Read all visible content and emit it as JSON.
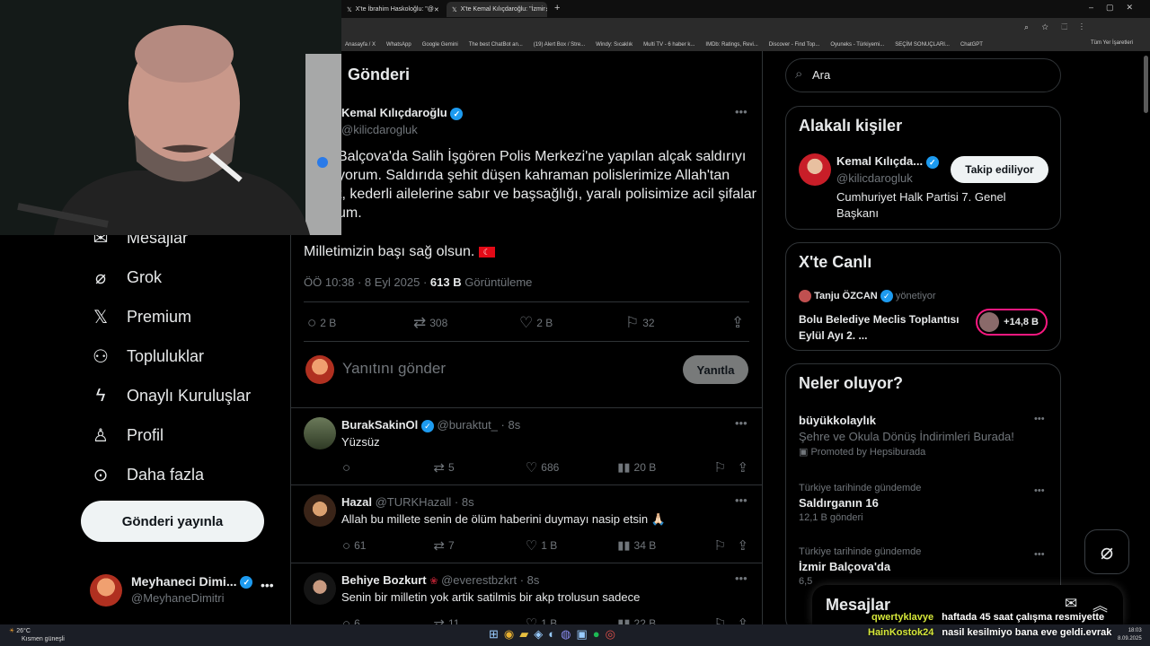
{
  "browser": {
    "tabs": [
      {
        "label": "X'te İbrahim Haskoloğlu: \"@"
      },
      {
        "label": "X'te Kemal Kılıçdaroğlu: \"İzmir"
      }
    ],
    "bookmarks": [
      "Anasayfa / X",
      "WhatsApp",
      "Google Gemini",
      "The best ChatBot an...",
      "(19) Alert Box / Stre...",
      "Windy: Sıcaklık",
      "Multi TV - 6 haber k...",
      "IMDb: Ratings, Revi...",
      "Discover - Find Top...",
      "Oyuneks - Türkiyemi...",
      "SEÇİM SONUÇLARI...",
      "ChatGPT"
    ],
    "all_bookmarks": "Tüm Yer İşaretleri"
  },
  "nav": {
    "items": [
      {
        "label": "Mesajlar",
        "icon": "mail-icon"
      },
      {
        "label": "Grok",
        "icon": "grok-icon"
      },
      {
        "label": "Premium",
        "icon": "x-logo-icon"
      },
      {
        "label": "Topluluklar",
        "icon": "communities-icon"
      },
      {
        "label": "Onaylı Kuruluşlar",
        "icon": "lightning-icon"
      },
      {
        "label": "Profil",
        "icon": "person-icon"
      },
      {
        "label": "Daha fazla",
        "icon": "more-circle-icon"
      }
    ],
    "post_button": "Gönderi yayınla",
    "account": {
      "name": "Meyhaneci Dimi...",
      "handle": "@MeyhaneDimitri"
    }
  },
  "main": {
    "header": "Gönderi",
    "post": {
      "author": "Kemal Kılıçdaroğlu",
      "handle": "@kilicdarogluk",
      "lines": [
        "Balçova'da Salih İşgören Polis Merkezi'ne yapılan alçak saldırıyı",
        "yorum. Saldırıda şehit düşen kahraman polislerimize Allah'tan",
        "t, kederli ailelerine sabır ve başsağlığı, yaralı polisimize acil şifalar",
        "um."
      ],
      "closing": "Milletimizin başı sağ olsun.",
      "time": "ÖÖ 10:38 · 8 Eyl 2025 ·",
      "views": "613 B",
      "views_label": "Görüntüleme",
      "replies": "2 B",
      "reposts": "308",
      "likes": "2 B",
      "bookmarks": "32"
    },
    "reply_box": {
      "placeholder": "Yanıtını gönder",
      "button": "Yanıtla"
    },
    "replies": [
      {
        "name": "BurakSakinOl",
        "handle": "@buraktut_ · 8s",
        "text": "Yüzsüz",
        "replies": "",
        "reposts": "5",
        "likes": "686",
        "views": "20 B"
      },
      {
        "name": "Hazal",
        "handle": "@TURKHazall · 8s",
        "text": "Allah bu millete senin de ölüm haberini duymayı nasip etsin 🙏🏻",
        "replies": "61",
        "reposts": "7",
        "likes": "1 B",
        "views": "34 B"
      },
      {
        "name": "Behiye Bozkurt",
        "handle": "@everestbzkrt · 8s",
        "text": "Senin bir milletin yok artik satilmis bir akp trolusun sadece",
        "replies": "6",
        "reposts": "11",
        "likes": "1 B",
        "views": "22 B"
      }
    ]
  },
  "right": {
    "search_placeholder": "Ara",
    "related": {
      "title": "Alakalı kişiler",
      "name": "Kemal Kılıçda...",
      "handle": "@kilicdarogluk",
      "follow": "Takip ediliyor",
      "bio": "Cumhuriyet Halk Partisi 7. Genel Başkanı"
    },
    "live": {
      "title": "X'te Canlı",
      "host": "Tanju ÖZCAN",
      "host_role": "yönetiyor",
      "topic": "Bolu Belediye Meclis Toplantısı Eylül Ayı 2. ...",
      "listeners": "+14,8 B"
    },
    "trends": {
      "title": "Neler oluyor?",
      "items": [
        {
          "context": "",
          "title": "büyükkolaylık",
          "sub": "Şehre ve Okula Dönüş İndirimleri Burada!",
          "meta": "Promoted by Hepsiburada"
        },
        {
          "context": "Türkiye tarihinde gündemde",
          "title": "Saldırganın 16",
          "sub": "",
          "meta": "12,1 B gönderi"
        },
        {
          "context": "Türkiye tarihinde gündemde",
          "title": "İzmir Balçova'da",
          "sub": "",
          "meta": "6,5"
        }
      ]
    },
    "messages_label": "Mesajlar"
  },
  "chat": [
    {
      "user": "qwertyklavye",
      "msg": "haftada 45 saat çalışma resmiyette"
    },
    {
      "user": "HainKostok24",
      "msg": "nasil kesilmiyo bana eve geldi.evrak"
    }
  ],
  "taskbar": {
    "weather": "26°C",
    "weather_sub": "Kısmen güneşli",
    "time": "18:03",
    "date": "8.09.2025"
  },
  "colors": {
    "accent": "#1d9bf0",
    "bg": "#000000",
    "border": "#2f3336",
    "muted": "#71767b",
    "chat_name": "#d6e83a"
  }
}
